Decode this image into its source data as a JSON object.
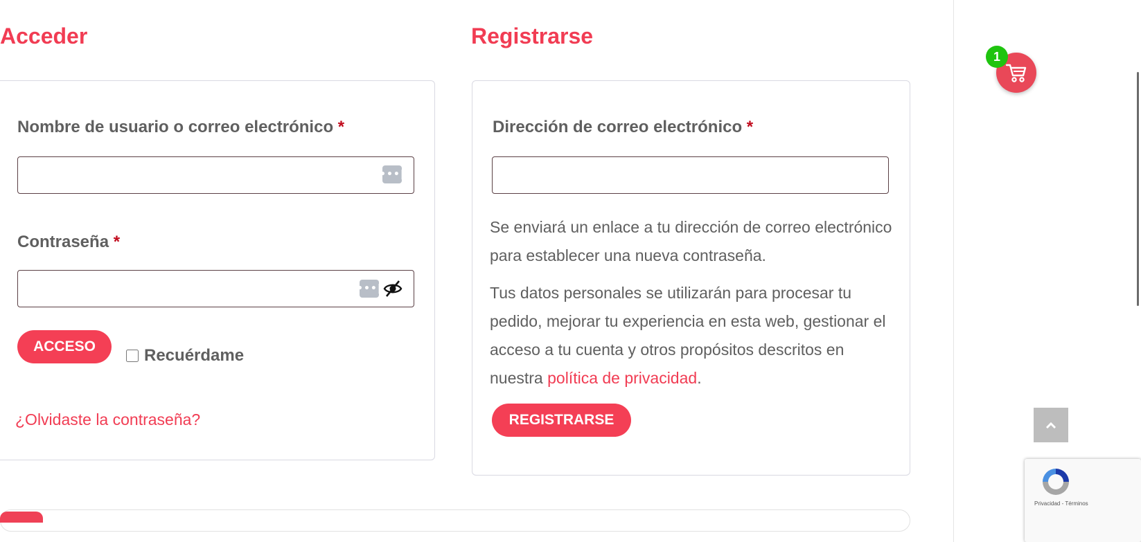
{
  "login": {
    "title": "Acceder",
    "username_label": "Nombre de usuario o correo electrónico",
    "password_label": "Contraseña",
    "required_mark": "*",
    "submit_label": "ACCESO",
    "remember_label": "Recuérdame",
    "forgot_label": "¿Olvidaste la contraseña?"
  },
  "register": {
    "title": "Registrarse",
    "email_label": "Dirección de correo electrónico",
    "required_mark": "*",
    "info_text": "Se enviará un enlace a tu dirección de correo electrónico para establecer una nueva contraseña.",
    "privacy_prefix": "Tus datos personales se utilizarán para procesar tu pedido, mejorar tu experiencia en esta web, gestionar el acceso a tu cuenta y otros propósitos descritos en nuestra",
    "privacy_link": "política de privacidad",
    "privacy_suffix": ".",
    "submit_label": "REGISTRARSE"
  },
  "cart": {
    "count": "1",
    "icon": "cart-icon"
  },
  "recaptcha": {
    "text": "Privacidad - Términos"
  },
  "icons": {
    "password_manager": "password-manager-icon",
    "visibility": "eye-off-icon",
    "scroll_top": "chevron-up-icon"
  },
  "colors": {
    "accent": "#f43f55",
    "required": "#c10b1d",
    "badge": "#1fc40f",
    "text": "#5f5f5f"
  }
}
